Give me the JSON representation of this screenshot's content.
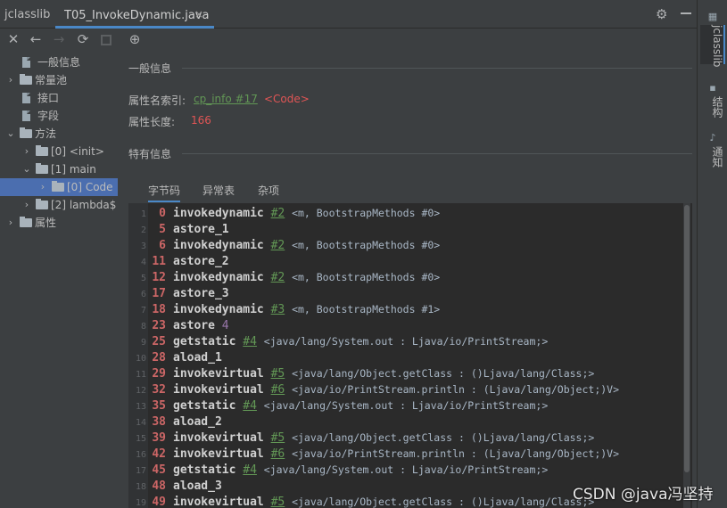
{
  "header": {
    "app_title": "jclasslib",
    "tab_label": "T05_InvokeDynamic.java",
    "tab_close": "×",
    "settings_icon": "gear-icon",
    "minimize_icon": "minus-icon"
  },
  "toolbar": {
    "close": "✕",
    "back": "←",
    "forward": "→",
    "refresh": "⟳",
    "web": "⊕"
  },
  "tree": {
    "items": [
      {
        "label": "一般信息",
        "type": "file",
        "level": 1,
        "arrow": ""
      },
      {
        "label": "常量池",
        "type": "folder",
        "level": 0,
        "arrow": "›"
      },
      {
        "label": "接口",
        "type": "file",
        "level": 1,
        "arrow": ""
      },
      {
        "label": "字段",
        "type": "file",
        "level": 1,
        "arrow": ""
      },
      {
        "label": "方法",
        "type": "folder",
        "level": 0,
        "arrow": "⌄"
      },
      {
        "label": "[0] <init>",
        "type": "folder",
        "level": 1,
        "arrow": "›"
      },
      {
        "label": "[1] main",
        "type": "folder",
        "level": 1,
        "arrow": "⌄"
      },
      {
        "label": "[0] Code",
        "type": "folder",
        "level": 2,
        "arrow": "›",
        "selected": true
      },
      {
        "label": "[2] lambda$",
        "type": "folder",
        "level": 1,
        "arrow": "›"
      },
      {
        "label": "属性",
        "type": "folder",
        "level": 0,
        "arrow": "›"
      }
    ]
  },
  "main": {
    "general_title": "一般信息",
    "attr_name_key": "属性名索引:",
    "attr_name_link": "cp_info #17",
    "attr_name_value": "<Code>",
    "attr_len_key": "属性长度:",
    "attr_len_value": "166",
    "specific_title": "特有信息",
    "tabs": [
      "字节码",
      "异常表",
      "杂项"
    ]
  },
  "code_lines": [
    {
      "n": "1",
      "off": "0",
      "op": "invokedynamic",
      "ref": "#2",
      "comment": "<m, BootstrapMethods #0>"
    },
    {
      "n": "2",
      "off": "5",
      "op": "astore_1"
    },
    {
      "n": "3",
      "off": "6",
      "op": "invokedynamic",
      "ref": "#2",
      "comment": "<m, BootstrapMethods #0>"
    },
    {
      "n": "4",
      "off": "11",
      "op": "astore_2"
    },
    {
      "n": "5",
      "off": "12",
      "op": "invokedynamic",
      "ref": "#2",
      "comment": "<m, BootstrapMethods #0>"
    },
    {
      "n": "6",
      "off": "17",
      "op": "astore_3"
    },
    {
      "n": "7",
      "off": "18",
      "op": "invokedynamic",
      "ref": "#3",
      "comment": "<m, BootstrapMethods #1>"
    },
    {
      "n": "8",
      "off": "23",
      "op": "astore",
      "num": "4"
    },
    {
      "n": "9",
      "off": "25",
      "op": "getstatic",
      "ref": "#4",
      "comment": "<java/lang/System.out : Ljava/io/PrintStream;>"
    },
    {
      "n": "10",
      "off": "28",
      "op": "aload_1"
    },
    {
      "n": "11",
      "off": "29",
      "op": "invokevirtual",
      "ref": "#5",
      "comment": "<java/lang/Object.getClass : ()Ljava/lang/Class;>"
    },
    {
      "n": "12",
      "off": "32",
      "op": "invokevirtual",
      "ref": "#6",
      "comment": "<java/io/PrintStream.println : (Ljava/lang/Object;)V>"
    },
    {
      "n": "13",
      "off": "35",
      "op": "getstatic",
      "ref": "#4",
      "comment": "<java/lang/System.out : Ljava/io/PrintStream;>"
    },
    {
      "n": "14",
      "off": "38",
      "op": "aload_2"
    },
    {
      "n": "15",
      "off": "39",
      "op": "invokevirtual",
      "ref": "#5",
      "comment": "<java/lang/Object.getClass : ()Ljava/lang/Class;>"
    },
    {
      "n": "16",
      "off": "42",
      "op": "invokevirtual",
      "ref": "#6",
      "comment": "<java/io/PrintStream.println : (Ljava/lang/Object;)V>"
    },
    {
      "n": "17",
      "off": "45",
      "op": "getstatic",
      "ref": "#4",
      "comment": "<java/lang/System.out : Ljava/io/PrintStream;>"
    },
    {
      "n": "18",
      "off": "48",
      "op": "aload_3"
    },
    {
      "n": "19",
      "off": "49",
      "op": "invokevirtual",
      "ref": "#5",
      "comment": "<java/lang/Object.getClass : ()Ljava/lang/Class;>"
    }
  ],
  "right_strip": {
    "tabs": [
      "jclasslib",
      "结构",
      "通知"
    ]
  },
  "watermark": "CSDN @java冯坚持"
}
